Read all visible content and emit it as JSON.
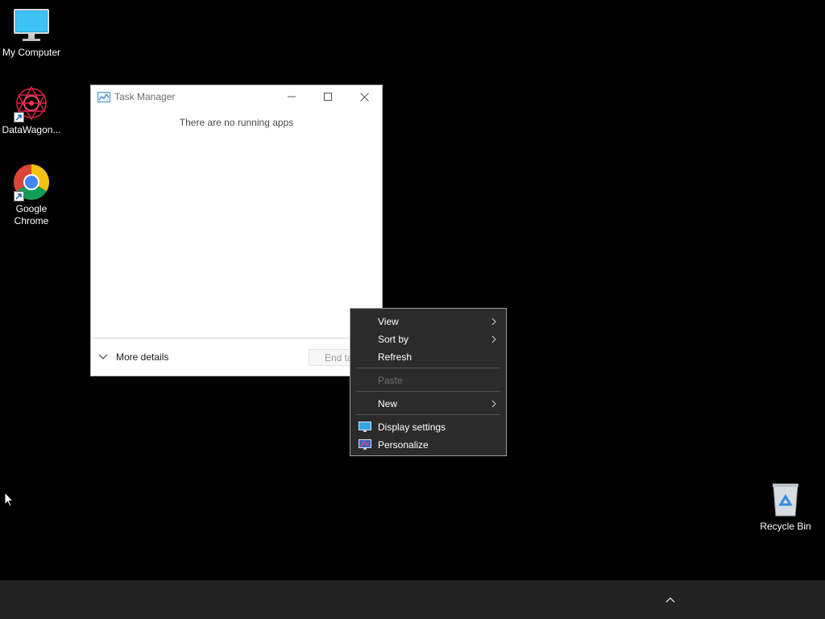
{
  "desktop": {
    "icons": [
      {
        "label": "My Computer",
        "icon": "monitor-icon"
      },
      {
        "label": "DataWagon...",
        "icon": "datawagon-logo-icon"
      },
      {
        "label": "Google Chrome",
        "icon": "chrome-icon"
      },
      {
        "label": "Recycle Bin",
        "icon": "recycle-bin-icon"
      }
    ]
  },
  "task_manager": {
    "title": "Task Manager",
    "empty_message": "There are no running apps",
    "more_details_label": "More details",
    "end_task_label": "End ta"
  },
  "context_menu": {
    "items": [
      {
        "label": "View",
        "has_submenu": true
      },
      {
        "label": "Sort by",
        "has_submenu": true
      },
      {
        "label": "Refresh"
      },
      {
        "label": "Paste",
        "disabled": true
      },
      {
        "label": "New",
        "has_submenu": true
      },
      {
        "label": "Display settings",
        "icon": "display-settings-icon"
      },
      {
        "label": "Personalize",
        "icon": "personalize-icon"
      }
    ]
  },
  "taskbar": {
    "tray_icon": "chevron-up-icon"
  },
  "colors": {
    "desktop_bg": "#000000",
    "taskbar_bg": "#232323",
    "menu_bg": "#2b2b2b",
    "window_bg": "#ffffff"
  }
}
